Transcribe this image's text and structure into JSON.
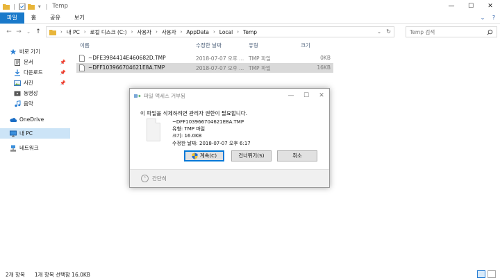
{
  "window": {
    "title": "Temp",
    "controls": [
      "minimize-icon",
      "maximize-icon",
      "close-icon"
    ]
  },
  "ribbon": {
    "tabs": [
      "파일",
      "홈",
      "공유",
      "보기"
    ]
  },
  "address": {
    "crumbs": [
      "내 PC",
      "로컬 디스크 (C:)",
      "사용자",
      "사용자",
      "AppData",
      "Local",
      "Temp"
    ]
  },
  "search": {
    "placeholder": "Temp 검색"
  },
  "sidebar": {
    "quick_access": "바로 가기",
    "items": [
      {
        "label": "문서",
        "icon": "document-icon",
        "pinned": true
      },
      {
        "label": "다운로드",
        "icon": "download-icon",
        "pinned": true
      },
      {
        "label": "사진",
        "icon": "picture-icon",
        "pinned": true
      },
      {
        "label": "동영상",
        "icon": "video-icon",
        "pinned": false
      },
      {
        "label": "음악",
        "icon": "music-icon",
        "pinned": false
      }
    ],
    "onedrive": "OneDrive",
    "this_pc": "내 PC",
    "network": "네트워크"
  },
  "list": {
    "columns": {
      "name": "이름",
      "modified": "수정한 날짜",
      "type": "유형",
      "size": "크기"
    },
    "rows": [
      {
        "name": "~DFE3984414E460682D.TMP",
        "modified": "2018-07-07 오후 ...",
        "type": "TMP 파일",
        "size": "0KB",
        "selected": false
      },
      {
        "name": "~DFF103966704621E8A.TMP",
        "modified": "2018-07-07 오후 ...",
        "type": "TMP 파일",
        "size": "16KB",
        "selected": true
      }
    ]
  },
  "dialog": {
    "title": "파일 액세스 거부됨",
    "message": "이 파일을 삭제하려면 관리자 권한이 필요합니다.",
    "file_name": "~DFF103966704621E8A.TMP",
    "file_type": "유형: TMP 파일",
    "file_size": "크기: 16.0KB",
    "file_modified": "수정한 날짜: 2018-07-07 오후 6:17",
    "buttons": {
      "continue": "계속(C)",
      "skip": "건너뛰기(S)",
      "cancel": "취소"
    },
    "footer": "간단히"
  },
  "status": {
    "count": "2개 항목",
    "selection": "1개 항목 선택함 16.0KB"
  },
  "colors": {
    "accent": "#1979ca",
    "selection": "#cce4f7",
    "row_selected": "#d9d9d9",
    "folder": "#e8b53a"
  }
}
